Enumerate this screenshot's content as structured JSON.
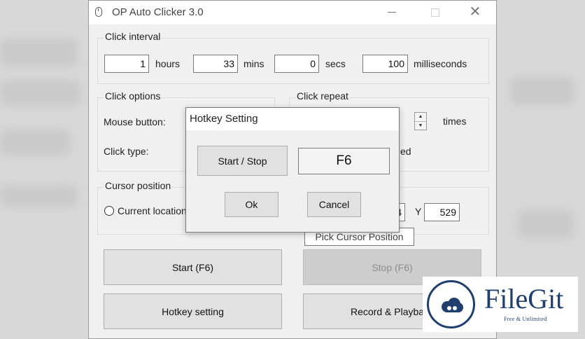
{
  "window": {
    "title": "OP Auto Clicker 3.0"
  },
  "click_interval": {
    "legend": "Click interval",
    "hours_value": "1",
    "hours_label": "hours",
    "mins_value": "33",
    "mins_label": "mins",
    "secs_value": "0",
    "secs_label": "secs",
    "ms_value": "100",
    "ms_label": "milliseconds"
  },
  "click_options": {
    "legend": "Click options",
    "mouse_button_label": "Mouse button:",
    "click_type_label": "Click type:"
  },
  "click_repeat": {
    "legend": "Click repeat",
    "times_label": "times",
    "partial_label": "ed"
  },
  "cursor_position": {
    "legend": "Cursor position",
    "current_location_label": "Current location",
    "x_partial": "4",
    "y_label": "Y",
    "y_value": "529",
    "pick_tooltip": "Pick Cursor Position"
  },
  "buttons": {
    "start": "Start (F6)",
    "stop": "Stop (F6)",
    "hotkey": "Hotkey setting",
    "record": "Record & Playba"
  },
  "hotkey_dialog": {
    "title": "Hotkey Setting",
    "action_label": "Start / Stop",
    "key": "F6",
    "ok": "Ok",
    "cancel": "Cancel"
  },
  "watermark": {
    "name": "FileGit",
    "tagline": "Free & Unlimited"
  },
  "colors": {
    "brand": "#1f3f6e"
  }
}
